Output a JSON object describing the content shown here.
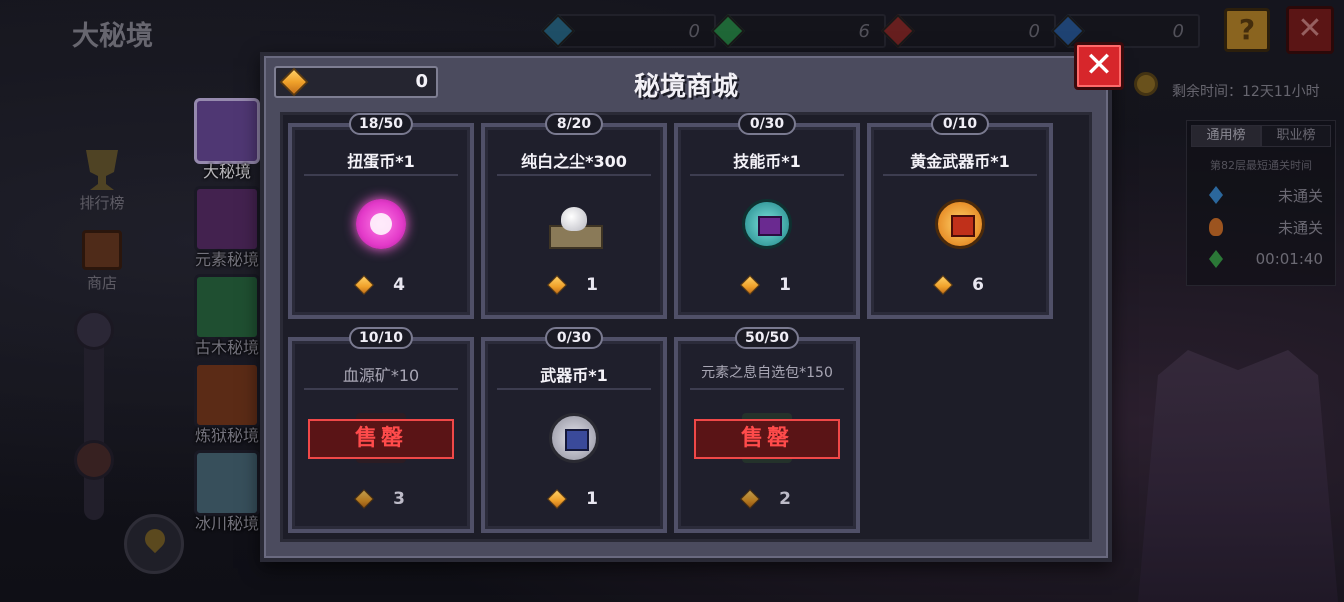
{
  "background": {
    "title": "大秘境",
    "top_resources": [
      "0",
      "6",
      "0",
      "0"
    ],
    "help_label": "?",
    "close_label": "✕",
    "left_nav": [
      {
        "label": "排行榜",
        "icon": "trophy-icon"
      },
      {
        "label": "商店",
        "icon": "shop-icon"
      }
    ],
    "realms": [
      {
        "label": "大秘境",
        "icon": "purple-realm-icon",
        "color": "#6a4a9a",
        "active": true
      },
      {
        "label": "元素秘境",
        "icon": "element-realm-icon",
        "color": "#5a2e6a",
        "active": false
      },
      {
        "label": "古木秘境",
        "icon": "forest-realm-icon",
        "color": "#2a6a42",
        "active": false
      },
      {
        "label": "炼狱秘境",
        "icon": "purgatory-realm-icon",
        "color": "#7a3a1e",
        "active": false
      },
      {
        "label": "冰川秘境",
        "icon": "glacier-realm-icon",
        "color": "#4a6a7a",
        "active": false
      }
    ],
    "remaining_time": "剩余时间：12天11小时",
    "leaderboard": {
      "tabs": [
        "通用榜",
        "职业榜"
      ],
      "subtitle": "第82层最短通关时间",
      "rows": [
        {
          "icon": "blue-diamond-icon",
          "color": "#3a8ad0",
          "value": "未通关"
        },
        {
          "icon": "flame-icon",
          "color": "#d0702a",
          "value": "未通关"
        },
        {
          "icon": "green-diamond-icon",
          "color": "#3aa04a",
          "value": "00:01:40"
        }
      ]
    }
  },
  "modal": {
    "title": "秘境商城",
    "currency_value": "0",
    "close_label": "✕",
    "soldout_label": "售罄",
    "items": [
      {
        "name": "扭蛋币*1",
        "stock": "18/50",
        "price": "4",
        "icon": "gacha-coin-icon",
        "sold_out": false
      },
      {
        "name": "纯白之尘*300",
        "stock": "8/20",
        "price": "1",
        "icon": "white-dust-icon",
        "sold_out": false
      },
      {
        "name": "技能币*1",
        "stock": "0/30",
        "price": "1",
        "icon": "skill-coin-icon",
        "sold_out": false
      },
      {
        "name": "黄金武器币*1",
        "stock": "0/10",
        "price": "6",
        "icon": "gold-weapon-coin-icon",
        "sold_out": false
      },
      {
        "name": "血源矿*10",
        "stock": "10/10",
        "price": "3",
        "icon": "blood-ore-icon",
        "sold_out": true
      },
      {
        "name": "武器币*1",
        "stock": "0/30",
        "price": "1",
        "icon": "weapon-coin-icon",
        "sold_out": false
      },
      {
        "name": "元素之息自选包*150",
        "stock": "50/50",
        "price": "2",
        "icon": "element-breath-pack-icon",
        "sold_out": true
      }
    ]
  }
}
